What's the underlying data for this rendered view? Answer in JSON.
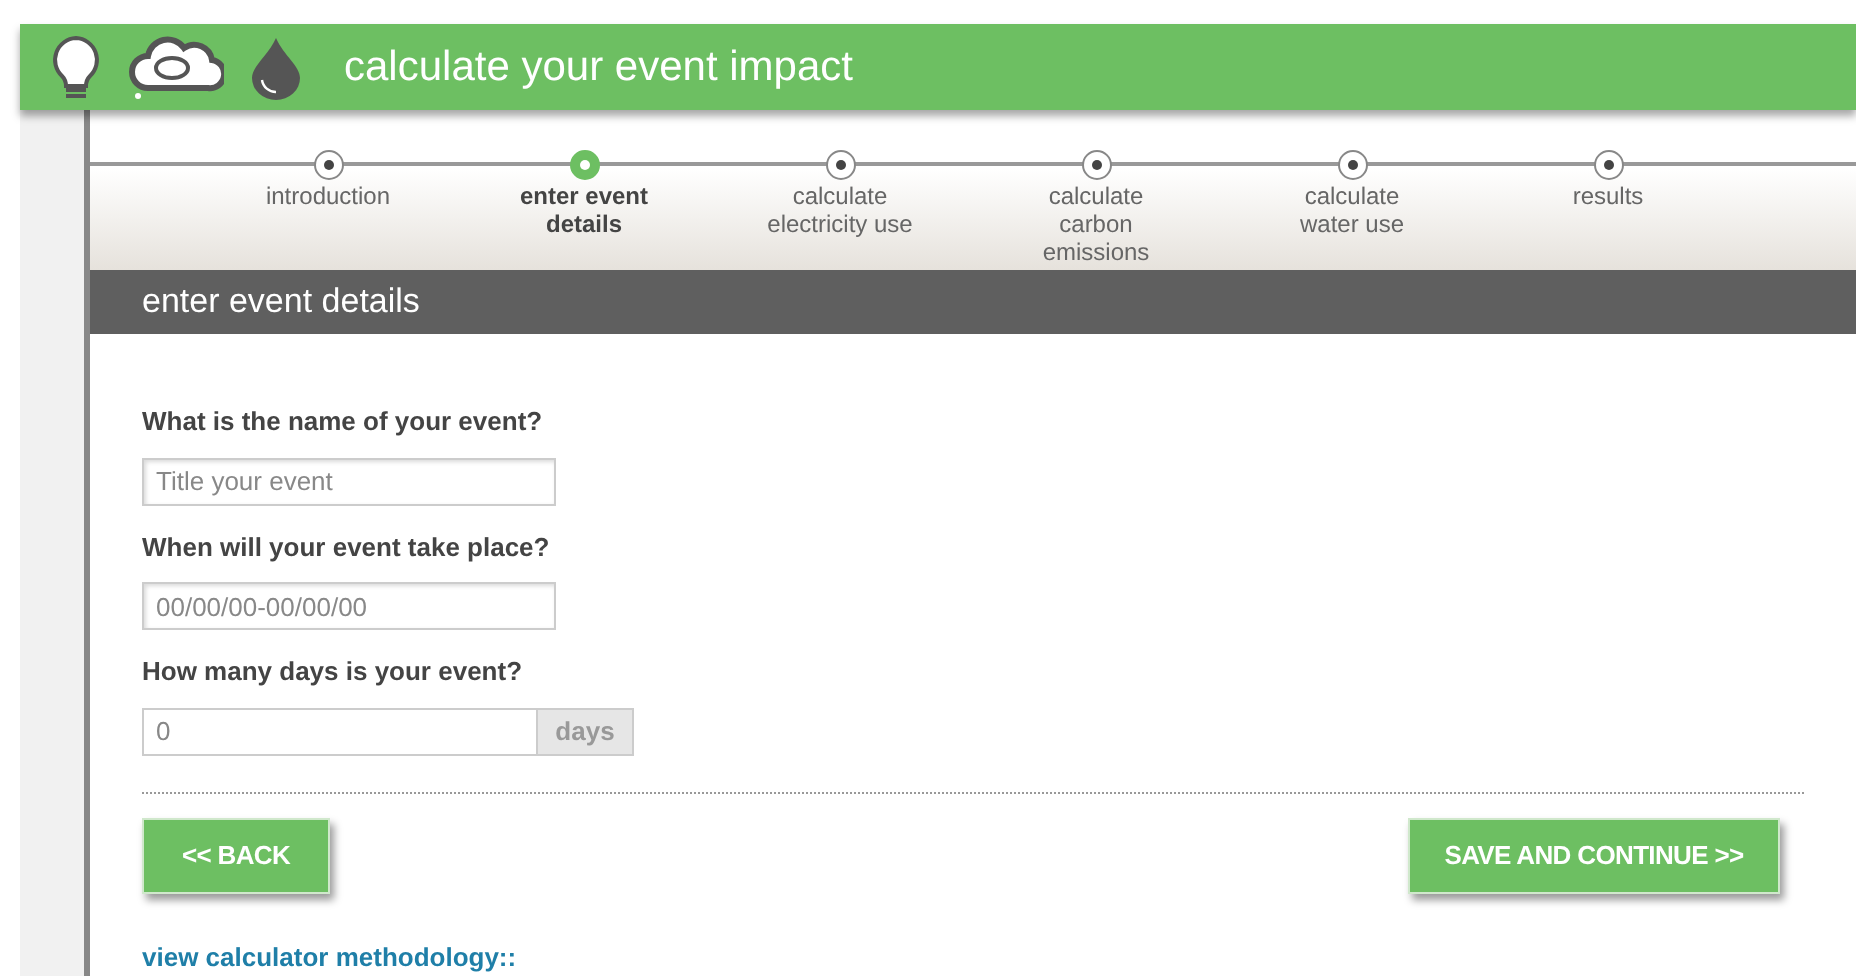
{
  "header": {
    "title": "calculate your event impact"
  },
  "steps": [
    {
      "label": "introduction",
      "selected": false
    },
    {
      "label": "enter event details",
      "selected": true
    },
    {
      "label": "calculate electricity use",
      "selected": false
    },
    {
      "label": "calculate carbon emissions",
      "selected": false
    },
    {
      "label": "calculate water use",
      "selected": false
    },
    {
      "label": "results",
      "selected": false
    }
  ],
  "section_title": "enter event details",
  "fields": [
    {
      "label": "What is the name of your event?",
      "placeholder": "Title your event"
    },
    {
      "label": "When will your event take place?",
      "placeholder": "00/00/00-00/00/00"
    },
    {
      "label": "How many days is your event?",
      "placeholder": "0",
      "suffix": "days"
    }
  ],
  "buttons": {
    "back": "<< BACK",
    "next": "SAVE AND CONTINUE >>"
  },
  "link": "view calculator methodology::"
}
